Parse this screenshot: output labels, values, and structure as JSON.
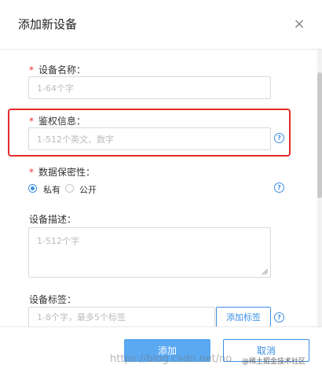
{
  "dialog": {
    "title": "添加新设备"
  },
  "form": {
    "device_name": {
      "label": "设备名称：",
      "placeholder": "1-64个字"
    },
    "auth_info": {
      "label": "鉴权信息：",
      "placeholder": "1-512个英文、数字"
    },
    "data_privacy": {
      "label": "数据保密性：",
      "options": [
        "私有",
        "公开"
      ],
      "selected": "私有"
    },
    "device_desc": {
      "label": "设备描述：",
      "placeholder": "1-512个字"
    },
    "device_tags": {
      "label": "设备标签：",
      "placeholder": "1-8个字，最多5个标签",
      "add_tag_label": "添加标签"
    }
  },
  "footer": {
    "add_label": "添加",
    "cancel_label": "取消",
    "watermark": "https://blog.csdn.net/no",
    "watermark_small": "@稀土掘金技术社区"
  },
  "colors": {
    "accent": "#3a8ee6",
    "primary_button": "#5aa9f1",
    "required": "#e33333",
    "highlight": "#e52a2a"
  }
}
